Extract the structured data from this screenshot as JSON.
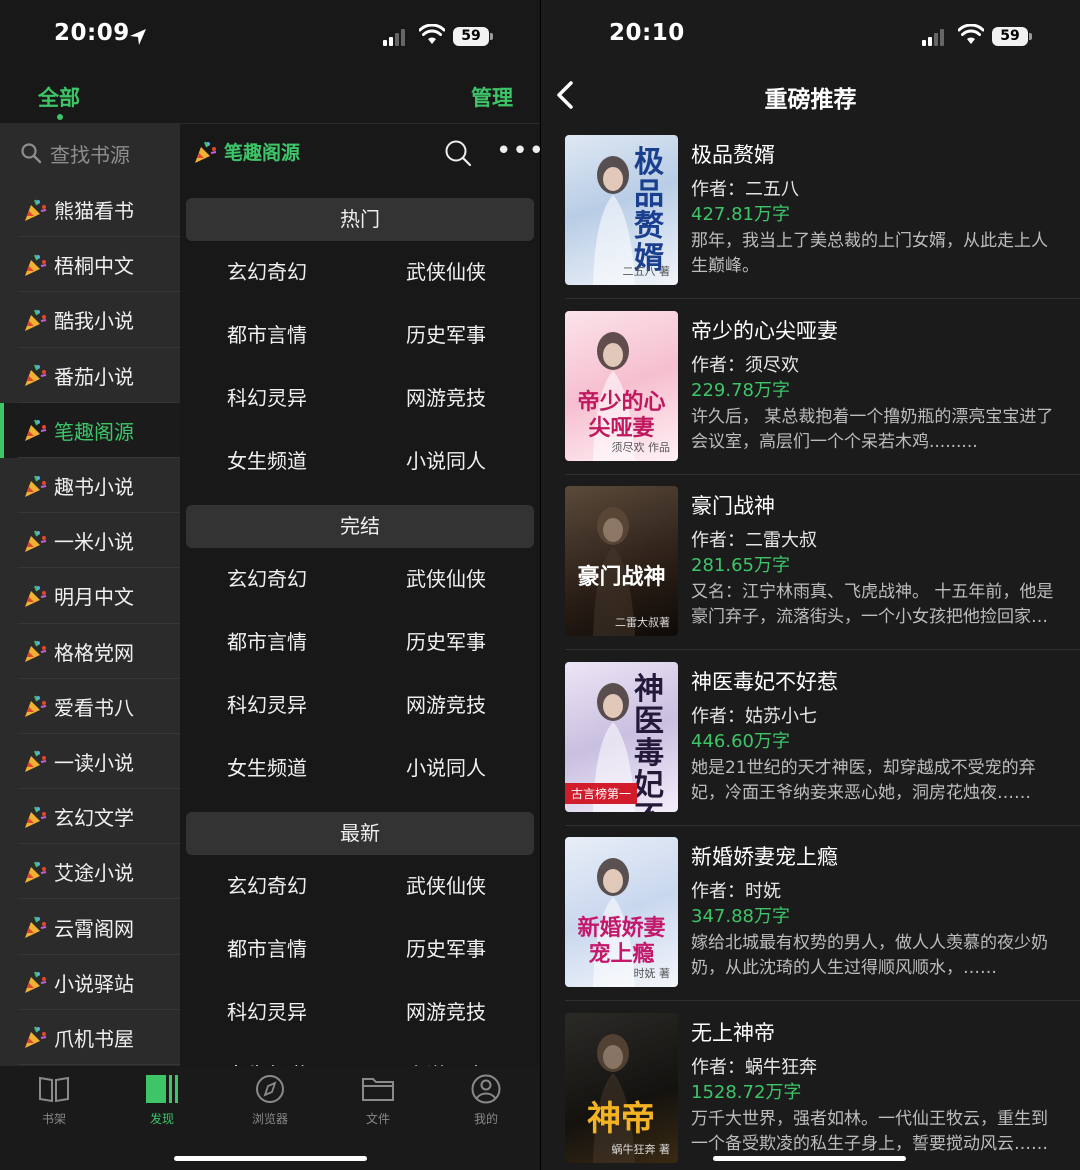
{
  "left": {
    "status": {
      "time": "20:09",
      "battery": "59"
    },
    "nav": {
      "all_tab": "全部",
      "manage": "管理"
    },
    "sidebar": {
      "search_placeholder": "查找书源",
      "items": [
        {
          "label": "熊猫看书"
        },
        {
          "label": "梧桐中文"
        },
        {
          "label": "酷我小说"
        },
        {
          "label": "番茄小说"
        },
        {
          "label": "笔趣阁源",
          "active": true
        },
        {
          "label": "趣书小说"
        },
        {
          "label": "一米小说"
        },
        {
          "label": "明月中文"
        },
        {
          "label": "格格党网"
        },
        {
          "label": "爱看书八"
        },
        {
          "label": "一读小说"
        },
        {
          "label": "玄幻文学"
        },
        {
          "label": "艾途小说"
        },
        {
          "label": "云霄阁网"
        },
        {
          "label": "小说驿站"
        },
        {
          "label": "爪机书屋"
        }
      ]
    },
    "pane": {
      "title": "笔趣阁源",
      "sections": [
        {
          "title": "热门",
          "items": [
            "玄幻奇幻",
            "武侠仙侠",
            "都市言情",
            "历史军事",
            "科幻灵异",
            "网游竞技",
            "女生频道",
            "小说同人"
          ]
        },
        {
          "title": "完结",
          "items": [
            "玄幻奇幻",
            "武侠仙侠",
            "都市言情",
            "历史军事",
            "科幻灵异",
            "网游竞技",
            "女生频道",
            "小说同人"
          ]
        },
        {
          "title": "最新",
          "items": [
            "玄幻奇幻",
            "武侠仙侠",
            "都市言情",
            "历史军事",
            "科幻灵异",
            "网游竞技",
            "女生频道",
            "小说同人"
          ]
        }
      ]
    },
    "tabbar": [
      {
        "label": "书架",
        "icon": "bookshelf-icon"
      },
      {
        "label": "发现",
        "icon": "discover-icon",
        "active": true
      },
      {
        "label": "浏览器",
        "icon": "compass-icon"
      },
      {
        "label": "文件",
        "icon": "folder-icon"
      },
      {
        "label": "我的",
        "icon": "profile-icon"
      }
    ]
  },
  "right": {
    "status": {
      "time": "20:10",
      "battery": "59"
    },
    "title": "重磅推荐",
    "books": [
      {
        "name": "极品赘婿",
        "author": "作者：二五八",
        "words": "427.81万字",
        "desc": "那年，我当上了美总裁的上门女婿，从此走上人生巅峰。",
        "cover_text": "极品赘婿",
        "cover_sub": "二五八 著"
      },
      {
        "name": "帝少的心尖哑妻",
        "author": "作者：须尽欢",
        "words": "229.78万字",
        "desc": "许久后， 某总裁抱着一个撸奶瓶的漂亮宝宝进了会议室，高层们一个个呆若木鸡.........",
        "cover_text": "帝少的心尖哑妻",
        "cover_sub": "须尽欢 作品"
      },
      {
        "name": "豪门战神",
        "author": "作者：二雷大叔",
        "words": "281.65万字",
        "desc": "又名：江宁林雨真、飞虎战神。 十五年前，他是豪门弃子，流落街头，一个小女孩把他捡回家，给他一口饭吃……",
        "cover_text": "豪门战神",
        "cover_sub": "二雷大叔著"
      },
      {
        "name": "神医毒妃不好惹",
        "author": "作者：姑苏小七",
        "words": "446.60万字",
        "desc": "她是21世纪的天才神医，却穿越成不受宠的弃妃，冷面王爷纳妾来恶心她，洞房花烛夜……",
        "cover_text": "神医毒妃不好惹",
        "cover_sub": "古言榜第一"
      },
      {
        "name": "新婚娇妻宠上瘾",
        "author": "作者：时妩",
        "words": "347.88万字",
        "desc": "嫁给北城最有权势的男人，做人人羡慕的夜少奶奶，从此沈琦的人生过得顺风顺水，……",
        "cover_text": "新婚娇妻宠上瘾",
        "cover_sub": "时妩 著"
      },
      {
        "name": "无上神帝",
        "author": "作者：蜗牛狂奔",
        "words": "1528.72万字",
        "desc": "万千大世界，强者如林。一代仙王牧云，重生到一个备受欺凌的私生子身上，誓要搅动风云……",
        "cover_text": "神帝",
        "cover_sub": "蜗牛狂奔 著"
      }
    ]
  },
  "colors": {
    "accent": "#3dc568",
    "background": "#181818",
    "sidebar": "#2b2b2b"
  }
}
